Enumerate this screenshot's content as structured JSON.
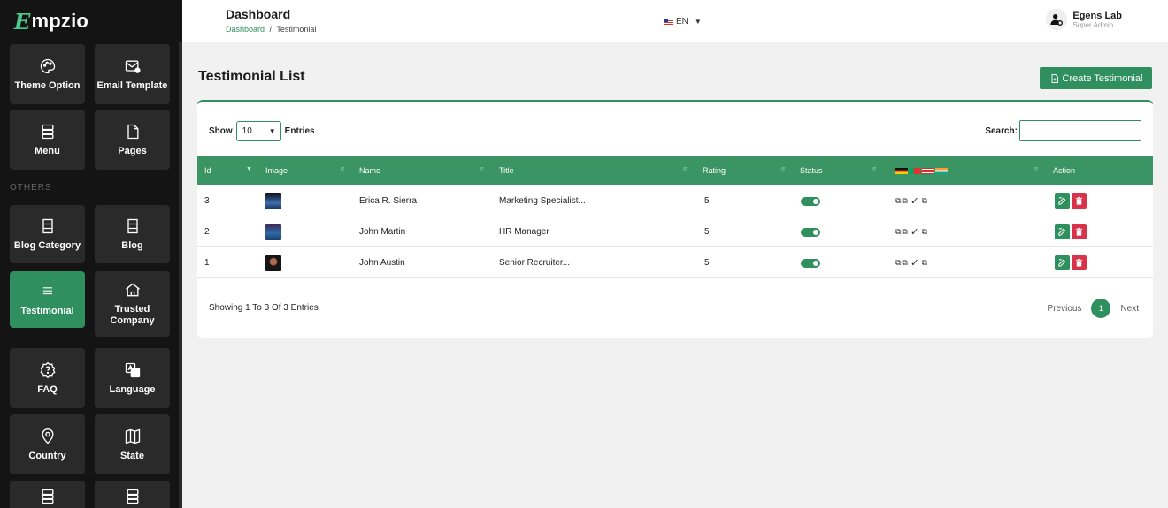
{
  "brand": {
    "letter": "E",
    "rest": "mpzio"
  },
  "header": {
    "title": "Dashboard",
    "breadcrumb_home": "Dashboard",
    "breadcrumb_sep": "/",
    "breadcrumb_current": "Testimonial",
    "language": "EN",
    "user_name": "Egens Lab",
    "user_role": "Super Admin"
  },
  "sidebar": {
    "section_label": "OTHERS",
    "items": [
      {
        "label": "Theme Option",
        "icon": "palette-icon"
      },
      {
        "label": "Email Template",
        "icon": "mail-plus-icon"
      },
      {
        "label": "Menu",
        "icon": "menu-stack-icon"
      },
      {
        "label": "Pages",
        "icon": "page-icon"
      },
      {
        "label": "Blog Category",
        "icon": "list-icon"
      },
      {
        "label": "Blog",
        "icon": "list-icon"
      },
      {
        "label": "Testimonial",
        "icon": "testimonial-icon",
        "active": true
      },
      {
        "label": "Trusted Company",
        "icon": "home-icon"
      },
      {
        "label": "FAQ",
        "icon": "question-icon"
      },
      {
        "label": "Language",
        "icon": "translate-icon"
      },
      {
        "label": "Country",
        "icon": "location-pin-icon"
      },
      {
        "label": "State",
        "icon": "map-icon"
      }
    ]
  },
  "main": {
    "title": "Testimonial List",
    "create_button": "Create Testimonial",
    "show_label": "Show",
    "entries_value": "10",
    "entries_label": "Entries",
    "search_label": "Search:",
    "columns": [
      "Id",
      "Image",
      "Name",
      "Title",
      "Rating",
      "Status",
      "",
      "Action"
    ],
    "rows": [
      {
        "id": "3",
        "name": "Erica R. Sierra",
        "title": "Marketing Specialist...",
        "rating": "5",
        "status_on": true
      },
      {
        "id": "2",
        "name": "John Martin",
        "title": "HR Manager",
        "rating": "5",
        "status_on": true
      },
      {
        "id": "1",
        "name": "John Austin",
        "title": "Senior Recruiter...",
        "rating": "5",
        "status_on": true
      }
    ],
    "showing_text": "Showing 1 To 3 Of 3 Entries",
    "pager": {
      "previous": "Previous",
      "current": "1",
      "next": "Next"
    }
  },
  "colors": {
    "accent": "#2f8f5e",
    "danger": "#d9334a",
    "sidebar_bg": "#141414",
    "tile_bg": "#2a2a2a"
  }
}
